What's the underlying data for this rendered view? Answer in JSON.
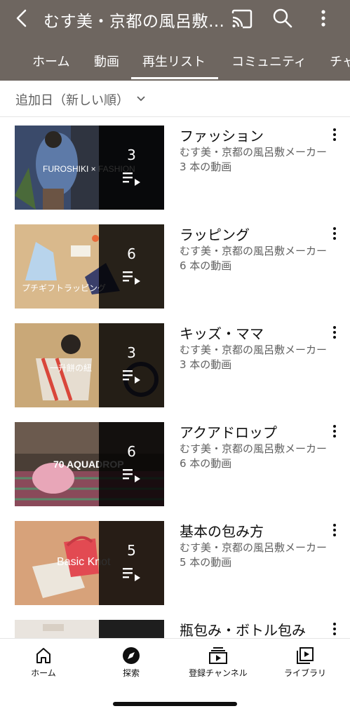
{
  "header": {
    "title": "むす美・京都の風呂敷メーカー",
    "tabs": [
      "ホーム",
      "動画",
      "再生リスト",
      "コミュニティ",
      "チャ"
    ],
    "active_tab": "再生リスト",
    "icons": {
      "back": "back-arrow-icon",
      "cast": "cast-icon",
      "search": "search-icon",
      "more": "more-vertical-icon"
    },
    "background_color": "#6e6660"
  },
  "sort": {
    "label": "追加日（新しい順）",
    "icon": "chevron-down-icon"
  },
  "playlists": [
    {
      "title": "ファッション",
      "channel": "むす美・京都の風呂敷メーカー",
      "video_count": "3 本の動画",
      "overlay_count": "3",
      "thumb_caption": "FUROSHIKI × FASHION",
      "thumb_color": "#3a4a6a"
    },
    {
      "title": "ラッピング",
      "channel": "むす美・京都の風呂敷メーカー",
      "video_count": "6 本の動画",
      "overlay_count": "6",
      "thumb_caption": "プチギフトラッピング",
      "thumb_color": "#d9b98c"
    },
    {
      "title": "キッズ・ママ",
      "channel": "むす美・京都の風呂敷メーカー",
      "video_count": "3 本の動画",
      "overlay_count": "3",
      "thumb_caption": "一升餅の紐",
      "thumb_color": "#c9a878"
    },
    {
      "title": "アクアドロップ",
      "channel": "むす美・京都の風呂敷メーカー",
      "video_count": "6 本の動画",
      "overlay_count": "6",
      "thumb_caption": "70 AQUADROP",
      "thumb_color": "#6b5a4e"
    },
    {
      "title": "基本の包み方",
      "channel": "むす美・京都の風呂敷メーカー",
      "video_count": "5 本の動画",
      "overlay_count": "5",
      "thumb_caption": "Basic Knot",
      "thumb_color": "#d7a27a"
    },
    {
      "title": "瓶包み・ボトル包み",
      "channel": "",
      "video_count": "",
      "overlay_count": "",
      "thumb_caption": "",
      "thumb_color": "#e9e4de"
    }
  ],
  "bottom_nav": [
    {
      "label": "ホーム",
      "icon": "home-icon"
    },
    {
      "label": "探索",
      "icon": "compass-icon"
    },
    {
      "label": "登録チャンネル",
      "icon": "subscriptions-icon"
    },
    {
      "label": "ライブラリ",
      "icon": "library-icon"
    }
  ]
}
